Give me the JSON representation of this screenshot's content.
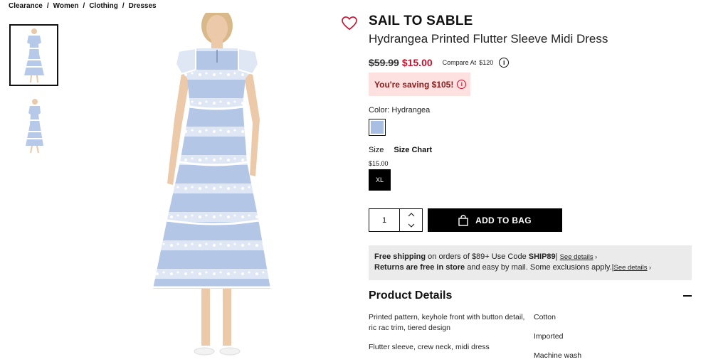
{
  "breadcrumb": [
    "Clearance",
    "Women",
    "Clothing",
    "Dresses"
  ],
  "product": {
    "brand": "SAIL TO SABLE",
    "name": "Hydrangea Printed Flutter Sleeve Midi Dress",
    "original_price": "$59.99",
    "sale_price": "$15.00",
    "compare_label": "Compare At",
    "compare_value": "$120",
    "saving_text": "You're saving $105!"
  },
  "color": {
    "label": "Color:",
    "value": "Hydrangea",
    "swatch_color": "#a8bfe3"
  },
  "size": {
    "label": "Size",
    "chart_link": "Size Chart",
    "price": "$15.00",
    "selected": "XL"
  },
  "quantity": "1",
  "add_to_bag": "ADD TO BAG",
  "shipping": {
    "free_bold": "Free shipping",
    "free_text": " on orders of $89+ Use Code ",
    "code": "SHIP89",
    "returns_bold": "Returns are free in store",
    "returns_text": " and easy by mail. Some exclusions apply.",
    "see_details": "See details"
  },
  "details": {
    "title": "Product Details",
    "left": [
      "Printed pattern, keyhole front with button detail, ric rac trim, tiered design",
      "Flutter sleeve, crew neck, midi dress"
    ],
    "right": [
      "Cotton",
      "Imported",
      "Machine wash"
    ]
  },
  "colors": {
    "sale_red": "#c8102e",
    "saving_bg": "#fde0e0",
    "dress_blue": "#a8bfe3"
  }
}
